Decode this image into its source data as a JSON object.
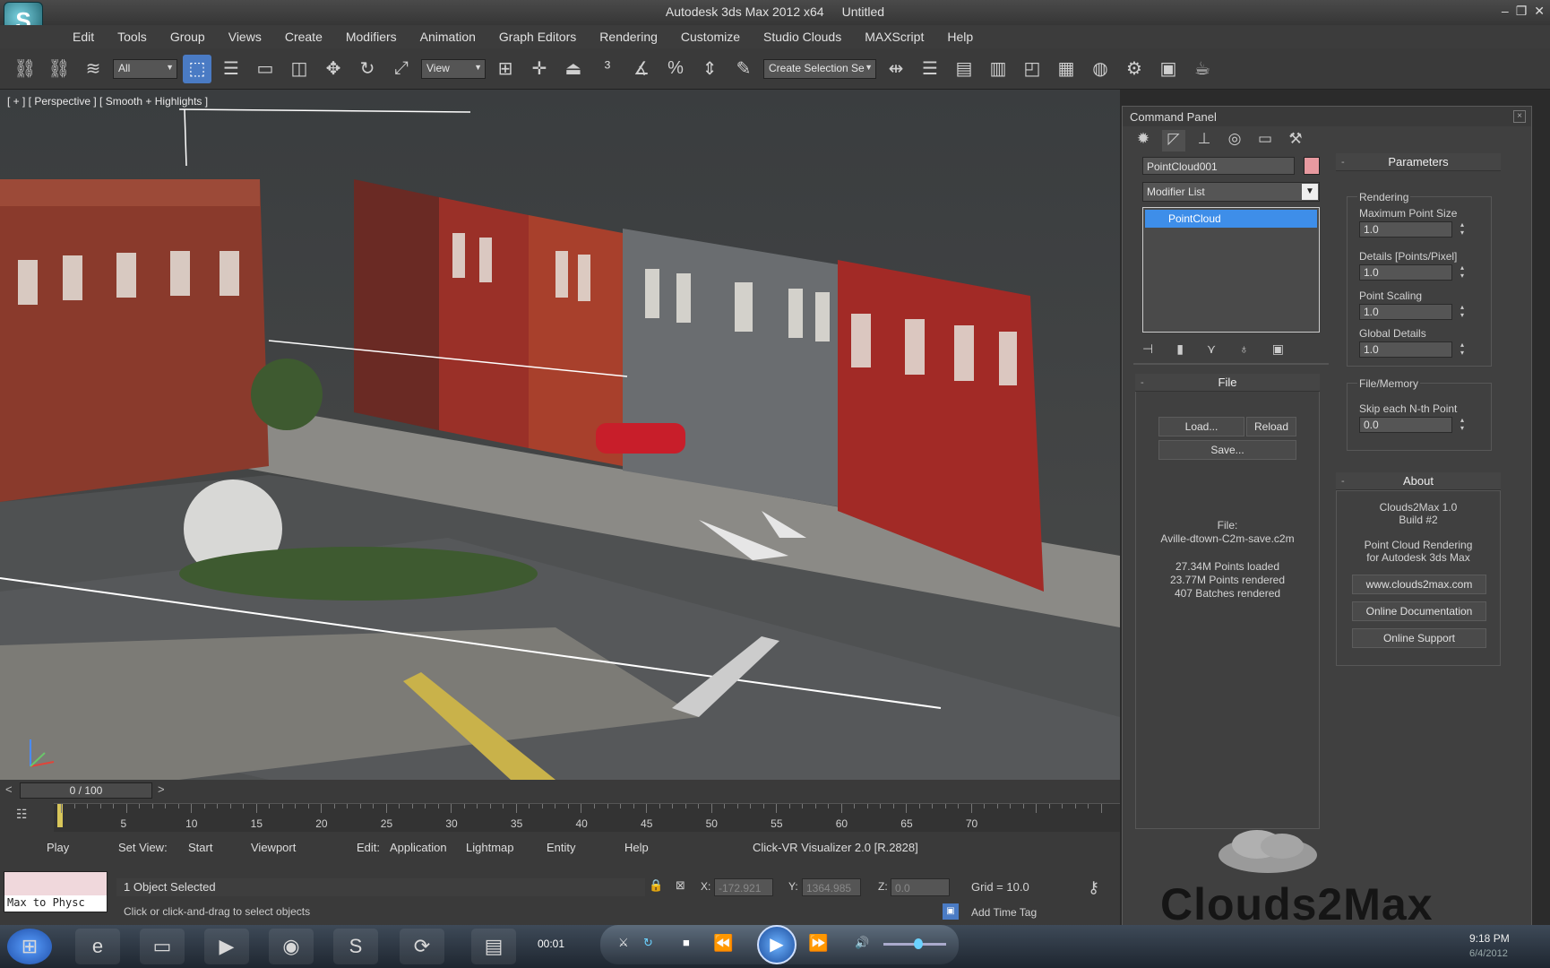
{
  "title": {
    "app": "Autodesk 3ds Max 2012 x64",
    "doc": "Untitled"
  },
  "menu": [
    "Edit",
    "Tools",
    "Group",
    "Views",
    "Create",
    "Modifiers",
    "Animation",
    "Graph Editors",
    "Rendering",
    "Customize",
    "Studio Clouds",
    "MAXScript",
    "Help"
  ],
  "toolbar": {
    "filter": "All",
    "ref_coord": "View",
    "named_selection": "Create Selection Se"
  },
  "viewport": {
    "label": "[ + ] [ Perspective ] [ Smooth + Highlights ]"
  },
  "command_panel": {
    "title": "Command Panel",
    "object_name": "PointCloud001",
    "object_color": "#e89aa0",
    "modifier_list": "Modifier List",
    "stack_item": "PointCloud",
    "file": {
      "header": "File",
      "load": "Load...",
      "reload": "Reload",
      "save": "Save...",
      "file_label": "File:",
      "file_name": "Aville-dtown-C2m-save.c2m",
      "points_loaded": "27.34M Points loaded",
      "points_rendered": "23.77M Points rendered",
      "batches_rendered": "407 Batches rendered"
    },
    "parameters": {
      "header": "Parameters",
      "rendering_group": "Rendering",
      "max_point_size_label": "Maximum Point Size",
      "max_point_size": "1.0",
      "details_label": "Details [Points/Pixel]",
      "details": "1.0",
      "point_scaling_label": "Point Scaling",
      "point_scaling": "1.0",
      "global_details_label": "Global Details",
      "global_details": "1.0",
      "file_memory_group": "File/Memory",
      "skip_label": "Skip each N-th Point",
      "skip": "0.0"
    },
    "about": {
      "header": "About",
      "product": "Clouds2Max 1.0",
      "build": "Build #2",
      "desc1": "Point Cloud Rendering",
      "desc2": "for Autodesk 3ds Max",
      "website": "www.clouds2max.com",
      "docs": "Online Documentation",
      "support": "Online Support"
    }
  },
  "timeline": {
    "position": "0 / 100",
    "ticks": [
      "5",
      "10",
      "15",
      "20",
      "25",
      "30",
      "35",
      "40",
      "45",
      "50",
      "55",
      "60",
      "65",
      "70"
    ]
  },
  "hud": {
    "play": "Play",
    "set_view": "Set View:",
    "start": "Start",
    "viewport": "Viewport",
    "edit": "Edit:",
    "application": "Application",
    "lightmap": "Lightmap",
    "entity": "Entity",
    "help": "Help",
    "visualizer": "Click-VR Visualizer 2.0 [R.2828]"
  },
  "status": {
    "maxscript": "Max to Physc",
    "selection": "1 Object Selected",
    "prompt": "Click or click-and-drag to select objects",
    "x_label": "X:",
    "x": "-172.921",
    "y_label": "Y:",
    "y": "1364.985",
    "z_label": "Z:",
    "z": "0.0",
    "grid": "Grid = 10.0",
    "add_time_tag": "Add Time Tag"
  },
  "taskbar": {
    "time_video": "00:01",
    "clock": "9:18 PM",
    "date": "6/4/2012"
  },
  "brand": "Clouds2Max"
}
